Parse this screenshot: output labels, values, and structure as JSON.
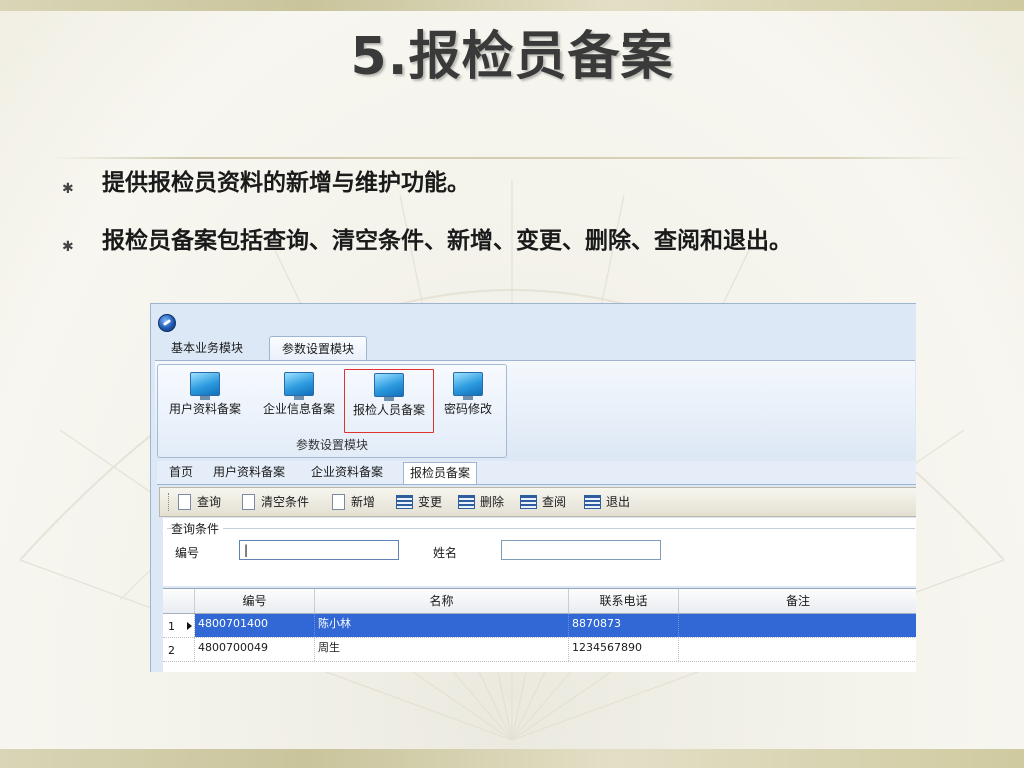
{
  "slide": {
    "title": "5.报检员备案",
    "bullets": [
      "提供报检员资料的新增与维护功能。",
      "报检员备案包括查询、清空条件、新增、变更、删除、查阅和退出。"
    ]
  },
  "app": {
    "ribbon_tabs": [
      "基本业务模块",
      "参数设置模块"
    ],
    "active_ribbon_tab": "参数设置模块",
    "ribbon_buttons": [
      "用户资料备案",
      "企业信息备案",
      "报检人员备案",
      "密码修改"
    ],
    "highlighted_button": "报检人员备案",
    "ribbon_group_label": "参数设置模块",
    "doc_tabs": [
      "首页",
      "用户资料备案",
      "企业资料备案",
      "报检员备案"
    ],
    "active_doc_tab": "报检员备案",
    "toolbar": [
      "查询",
      "清空条件",
      "新增",
      "变更",
      "删除",
      "查阅",
      "退出"
    ],
    "query": {
      "legend": "查询条件",
      "id_label": "编号",
      "id_value": "|",
      "name_label": "姓名",
      "name_value": ""
    },
    "grid": {
      "columns": [
        "编号",
        "名称",
        "联系电话",
        "备注"
      ],
      "rows": [
        {
          "index": "1",
          "id": "4800701400",
          "name": "陈小林",
          "phone": "8870873",
          "note": ""
        },
        {
          "index": "2",
          "id": "4800700049",
          "name": "周生",
          "phone": "1234567890",
          "note": ""
        }
      ],
      "selected_row": 1
    }
  },
  "colors": {
    "selection": "#3168d5",
    "highlight_border": "#e03131",
    "title_text": "#3a3a3a"
  }
}
